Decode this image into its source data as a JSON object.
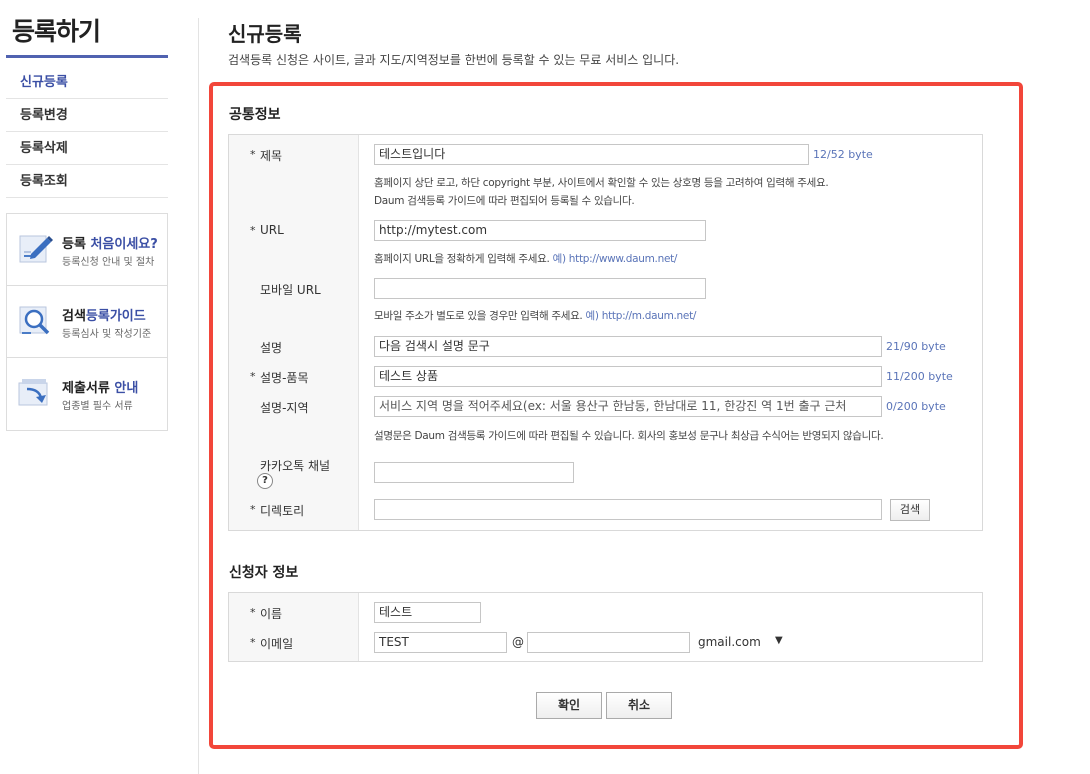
{
  "sidebar": {
    "title": "등록하기",
    "menu": [
      {
        "label": "신규등록"
      },
      {
        "label": "등록변경"
      },
      {
        "label": "등록삭제"
      },
      {
        "label": "등록조회"
      }
    ],
    "guides": [
      {
        "title_a": "등록 ",
        "title_b": "처음이세요?",
        "sub": "등록신청 안내 및 절차",
        "icon": "pencil-doc-icon"
      },
      {
        "title_a": "검색",
        "title_b": "등록가이드",
        "sub": "등록심사 및 작성기준",
        "icon": "magnifier-doc-icon"
      },
      {
        "title_a": "제출서류 ",
        "title_b": "안내",
        "sub": "업종별 필수 서류",
        "icon": "documents-arrow-icon"
      }
    ]
  },
  "main": {
    "title": "신규등록",
    "desc": "검색등록 신청은 사이트, 글과 지도/지역정보를 한번에 등록할 수 있는 무료 서비스 입니다."
  },
  "common": {
    "section_title": "공통정보",
    "title_field": {
      "label": "제목",
      "value": "테스트입니다",
      "byte": "12/52 byte",
      "help1": "홈페이지 상단 로고, 하단 copyright 부분, 사이트에서 확인할 수 있는 상호명 등을 고려하여 입력해 주세요.",
      "help2": "Daum 검색등록 가이드에 따라 편집되어 등록될 수 있습니다."
    },
    "url_field": {
      "label": "URL",
      "value": "http://mytest.com",
      "help": "홈페이지 URL을 정확하게 입력해 주세요.",
      "example": "예) http://www.daum.net/"
    },
    "mobile_url_field": {
      "label": "모바일 URL",
      "value": "",
      "help": "모바일 주소가 별도로 있을 경우만 입력해 주세요.",
      "example": "예) http://m.daum.net/"
    },
    "desc_field": {
      "label": "설명",
      "value": "다음 검색시 설명 문구",
      "byte": "21/90 byte"
    },
    "desc_item_field": {
      "label": "설명-품목",
      "value": "테스트 상품",
      "byte": "11/200 byte"
    },
    "desc_region_field": {
      "label": "설명-지역",
      "placeholder": "서비스 지역 명을 적어주세요(ex: 서울  용산구 한남동, 한남대로 11, 한강진 역 1번 출구 근처",
      "byte": "0/200 byte",
      "help": "설명문은 Daum 검색등록 가이드에 따라 편집될 수 있습니다. 회사의 홍보성 문구나 최상급 수식어는 반영되지 않습니다."
    },
    "kakao_field": {
      "label": "카카오톡 채널",
      "value": "",
      "qmark": "?"
    },
    "directory_field": {
      "label": "디렉토리",
      "value": "",
      "search_label": "검색"
    }
  },
  "applicant": {
    "section_title": "신청자 정보",
    "name_field": {
      "label": "이름",
      "value": "테스트"
    },
    "email_field": {
      "label": "이메일",
      "local": "TEST",
      "at": "@",
      "domain_input": "",
      "domain_select": "gmail.com",
      "arrow": "▼"
    }
  },
  "buttons": {
    "confirm": "확인",
    "cancel": "취소"
  },
  "star": "*",
  "colors": {
    "accent": "#3b4fa5",
    "frame": "#f2463a",
    "byte": "#5a74b8"
  }
}
